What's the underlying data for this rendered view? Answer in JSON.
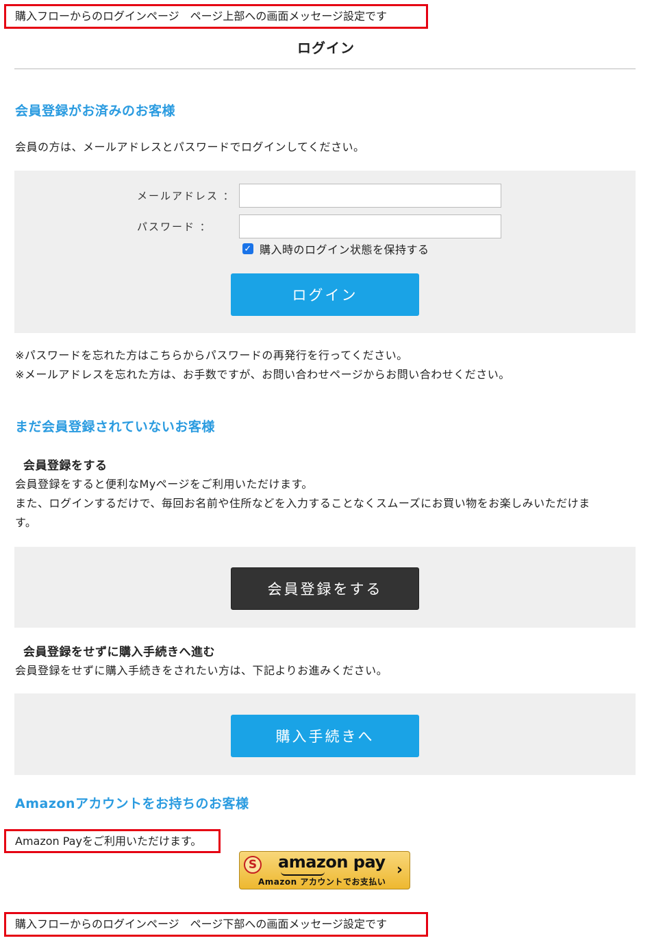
{
  "top_message": "購入フローからのログインページ　ページ上部への画面メッセージ設定です",
  "page_title": "ログイン",
  "member": {
    "heading": "会員登録がお済みのお客様",
    "intro": "会員の方は、メールアドレスとパスワードでログインしてください。",
    "email_label": "メールアドレス ：",
    "email_value": "",
    "password_label": "パスワード ：",
    "password_value": "",
    "remember_label": "購入時のログイン状態を保持する",
    "remember_checked": true,
    "login_button": "ログイン",
    "note_password": "※パスワードを忘れた方はこちらからパスワードの再発行を行ってください。",
    "note_email": "※メールアドレスを忘れた方は、お手数ですが、お問い合わせページからお問い合わせください。"
  },
  "guest": {
    "heading": "まだ会員登録されていないお客様",
    "register_heading": "会員登録をする",
    "register_text_1": "会員登録をすると便利なMyページをご利用いただけます。",
    "register_text_2a": "また、ログインするだけで、毎回お名前や住所などを入力することなくスムーズにお買い物をお楽しみいただけま",
    "register_text_2b": "す。",
    "register_button": "会員登録をする",
    "checkout_heading": "会員登録をせずに購入手続きへ進む",
    "checkout_text": "会員登録をせずに購入手続きをされたい方は、下記よりお進みください。",
    "checkout_button": "購入手続きへ"
  },
  "amazon": {
    "heading": "Amazonアカウントをお持ちのお客様",
    "message": "Amazon Payをご利用いただけます。",
    "button_logo": "amazon pay",
    "button_sub": "Amazon アカウントでお支払い",
    "button_icon": "amazon-pay-s-icon",
    "chevron": "›"
  },
  "bottom_message": "購入フローからのログインページ　ページ下部への画面メッセージ設定です",
  "colors": {
    "accent_blue": "#1aa3e6",
    "heading_blue": "#2a9be0",
    "message_border_red": "#e50012",
    "panel_gray": "#efefef",
    "dark_button": "#333333"
  }
}
